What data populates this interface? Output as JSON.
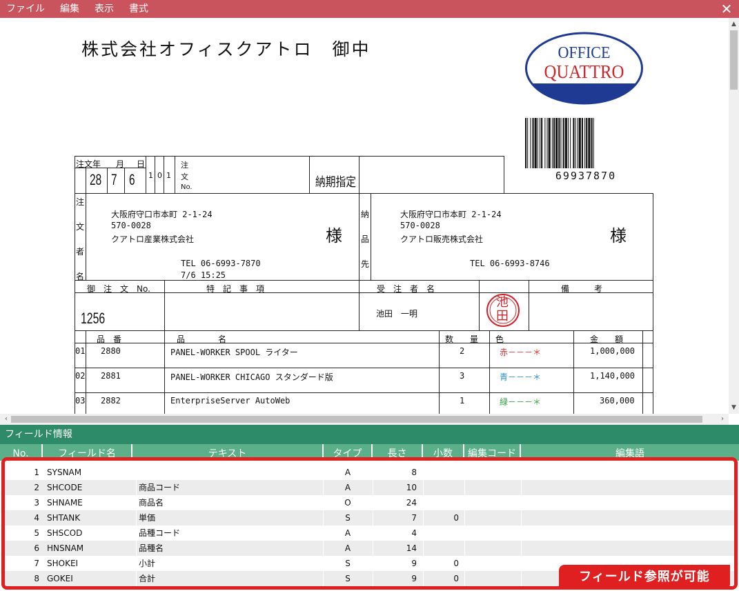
{
  "menubar": {
    "items": [
      "ファイル",
      "編集",
      "表示",
      "書式"
    ],
    "close_glyph": "✕"
  },
  "document": {
    "title": "株式会社オフィスクアトロ　御中",
    "logo": {
      "line1": "OFFICE",
      "line2": "QUATTRO"
    },
    "barcode_number": "69937870",
    "order_date": {
      "label_y": "注文年",
      "label_m": "月",
      "label_d": "日",
      "year": "28",
      "month": "7",
      "day": "6",
      "extra1": "1",
      "extra2": "0",
      "extra3": "1"
    },
    "order_no_label": [
      "注",
      "文",
      "No."
    ],
    "delivery_label": "納期指定",
    "orderer": {
      "side_label": [
        "注",
        "文",
        "者",
        "名"
      ],
      "address": "大阪府守口市本町 2-1-24",
      "zip": "570-0028",
      "company": "クアトロ産業株式会社",
      "honorific": "様",
      "tel": "TEL 06-6993-7870",
      "datetime": "7/6 15:25"
    },
    "delivery": {
      "side_label": [
        "納",
        "品",
        "先"
      ],
      "address": "大阪府守口市本町 2-1-24",
      "zip": "570-0028",
      "company": "クアトロ販売株式会社",
      "honorific": "様",
      "tel": "TEL 06-6993-8746"
    },
    "section_headers": {
      "order_no": "御　注　文　No.",
      "remarks": "特　記　事　項",
      "receiver": "受　注　者　名",
      "notes": "備　　　考"
    },
    "order_number": "1256",
    "receiver_name": "池田　一明",
    "stamp": {
      "line1": "池",
      "line2": "田"
    },
    "items_headers": {
      "code": "品　番",
      "name": "品　　　　名",
      "qty": "数　　量",
      "color": "色",
      "amount": "金　　額"
    },
    "items": [
      {
        "no": "01",
        "code": "2880",
        "name": "PANEL-WORKER SPOOL ライター",
        "qty": "2",
        "color": "赤－－－＊",
        "color_hex": "#e03030",
        "amount": "1,000,000"
      },
      {
        "no": "02",
        "code": "2881",
        "name": "PANEL-WORKER CHICAGO スタンダード版",
        "qty": "3",
        "color": "青－－－＊",
        "color_hex": "#2f8fc8",
        "amount": "1,140,000"
      },
      {
        "no": "03",
        "code": "2882",
        "name": "EnterpriseServer AutoWeb",
        "qty": "1",
        "color": "緑－－－＊",
        "color_hex": "#3aa040",
        "amount": "360,000"
      }
    ]
  },
  "field_panel": {
    "title": "フィールド情報",
    "columns": [
      "No.",
      "フィールド名",
      "テキスト",
      "タイプ",
      "長さ",
      "小数",
      "編集コード",
      "編集語"
    ],
    "rows": [
      {
        "no": "1",
        "name": "SYSNAM",
        "text": "",
        "type": "A",
        "length": "8",
        "decimal": ""
      },
      {
        "no": "2",
        "name": "SHCODE",
        "text": "商品コード",
        "type": "A",
        "length": "10",
        "decimal": ""
      },
      {
        "no": "3",
        "name": "SHNAME",
        "text": "商品名",
        "type": "O",
        "length": "24",
        "decimal": ""
      },
      {
        "no": "4",
        "name": "SHTANK",
        "text": "単価",
        "type": "S",
        "length": "7",
        "decimal": "0"
      },
      {
        "no": "5",
        "name": "SHSCOD",
        "text": "品種コード",
        "type": "A",
        "length": "4",
        "decimal": ""
      },
      {
        "no": "6",
        "name": "HNSNAM",
        "text": "品種名",
        "type": "A",
        "length": "14",
        "decimal": ""
      },
      {
        "no": "7",
        "name": "SHOKEI",
        "text": "小計",
        "type": "S",
        "length": "9",
        "decimal": "0"
      },
      {
        "no": "8",
        "name": "GOKEI",
        "text": "合計",
        "type": "S",
        "length": "9",
        "decimal": "0"
      }
    ],
    "badge": "フィールド参照が可能"
  },
  "colors": {
    "menubar": "#c9545e",
    "panel": "#2e8b6a",
    "header": "#5bb08a",
    "highlight": "#e02020",
    "logo_blue": "#1f3a93",
    "logo_red": "#d0232a"
  }
}
